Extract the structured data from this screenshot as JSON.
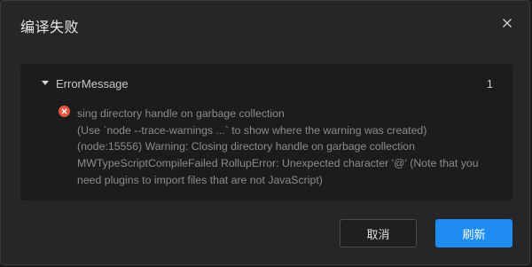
{
  "dialog": {
    "title": "编译失败",
    "close_icon": "close-icon"
  },
  "errors": {
    "group_name": "ErrorMessage",
    "count": "1",
    "lines": [
      "sing directory handle on garbage collection",
      "(Use `node --trace-warnings ...` to show where the warning was created)",
      "(node:15556) Warning: Closing directory handle on garbage collection",
      "MWTypeScriptCompileFailed RollupError: Unexpected character '@' (Note that you",
      "need plugins to import files that are not JavaScript)"
    ],
    "icon": "error-circle-icon",
    "icon_color": "#e5553f"
  },
  "buttons": {
    "cancel_label": "取消",
    "refresh_label": "刷新",
    "primary_color": "#1f8cf2"
  }
}
